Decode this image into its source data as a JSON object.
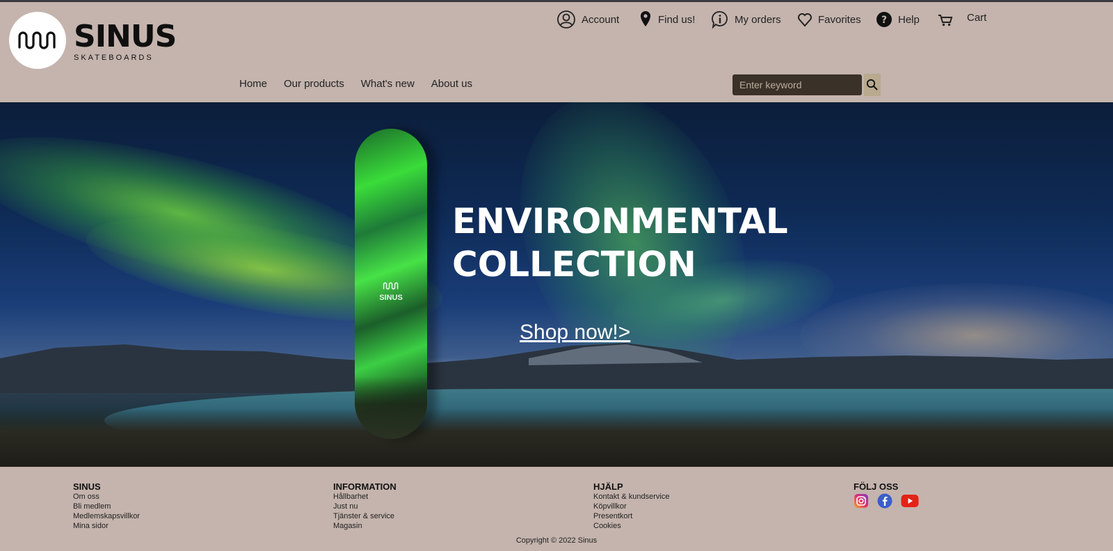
{
  "brand": {
    "name": "SINUS",
    "tagline": "SKATEBOARDS"
  },
  "utility_nav": [
    {
      "label": "Account",
      "icon": "account-icon"
    },
    {
      "label": "Find us!",
      "icon": "location-pin-icon"
    },
    {
      "label": "My orders",
      "icon": "info-icon"
    },
    {
      "label": "Favorites",
      "icon": "heart-icon"
    },
    {
      "label": "Help",
      "icon": "help-icon"
    },
    {
      "label": "Cart",
      "icon": "cart-icon"
    }
  ],
  "main_nav": [
    {
      "label": "Home"
    },
    {
      "label": "Our products"
    },
    {
      "label": "What's new"
    },
    {
      "label": "About us"
    }
  ],
  "search": {
    "placeholder": "Enter keyword",
    "button_icon": "search-icon"
  },
  "hero": {
    "title_line1": "ENVIRONMENTAL",
    "title_line2": "COLLECTION",
    "cta": "Shop now!>",
    "board_brand": "SINUS"
  },
  "footer": {
    "columns": [
      {
        "heading": "SINUS",
        "links": [
          "Om oss",
          "Bli medlem",
          "Medlemskapsvillkor",
          "Mina sidor"
        ]
      },
      {
        "heading": "INFORMATION",
        "links": [
          "Hållbarhet",
          "Just nu",
          "Tjänster & service",
          "Magasin"
        ]
      },
      {
        "heading": "HJÄLP",
        "links": [
          "Kontakt & kundservice",
          "Köpvillkor",
          "Presentkort",
          "Cookies"
        ]
      },
      {
        "heading": "FÖLJ OSS",
        "links": []
      }
    ],
    "social": [
      "instagram-icon",
      "facebook-icon",
      "youtube-icon"
    ],
    "copyright": "Copyright © 2022 Sinus"
  },
  "colors": {
    "background": "#c4b4ad",
    "search_field": "#3a3128",
    "search_button": "#b8a98f",
    "hero_text": "#ffffff"
  }
}
